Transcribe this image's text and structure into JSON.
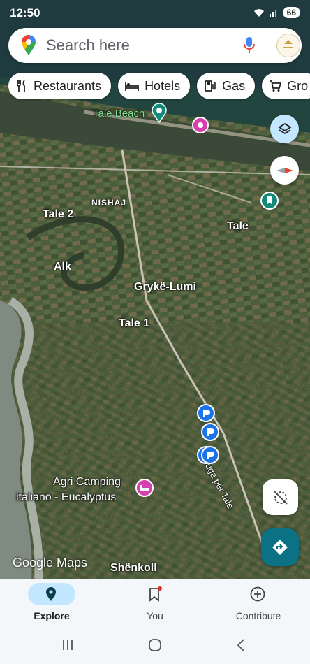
{
  "status_bar": {
    "time": "12:50",
    "battery": "66"
  },
  "search": {
    "placeholder": "Search here"
  },
  "chips": [
    {
      "label": "Restaurants",
      "icon": "fork-knife-icon"
    },
    {
      "label": "Hotels",
      "icon": "bed-icon"
    },
    {
      "label": "Gas",
      "icon": "gas-pump-icon"
    },
    {
      "label": "Gro",
      "icon": "cart-icon"
    }
  ],
  "map": {
    "style": "satellite",
    "places": {
      "tale_beach": "Tale Beach",
      "nishaj": "NISHAJ",
      "tale2": "Tale 2",
      "tale": "Tale",
      "alk": "Alk",
      "gryke_lumi": "Grykë-Lumi",
      "tale1": "Tale 1",
      "rruga": "Rruga për Tale",
      "camping1": "Agri Camping",
      "camping2": "italiano - Eucalyptus",
      "shenkoll": "Shënkoll"
    },
    "watermark": "Google Maps",
    "colors": {
      "accent": "#1a73e8",
      "directions": "#0b7285",
      "pink": "#d63fae",
      "teal": "#12897a"
    }
  },
  "bottom_nav": {
    "explore": "Explore",
    "you": "You",
    "contribute": "Contribute",
    "active": "explore"
  }
}
